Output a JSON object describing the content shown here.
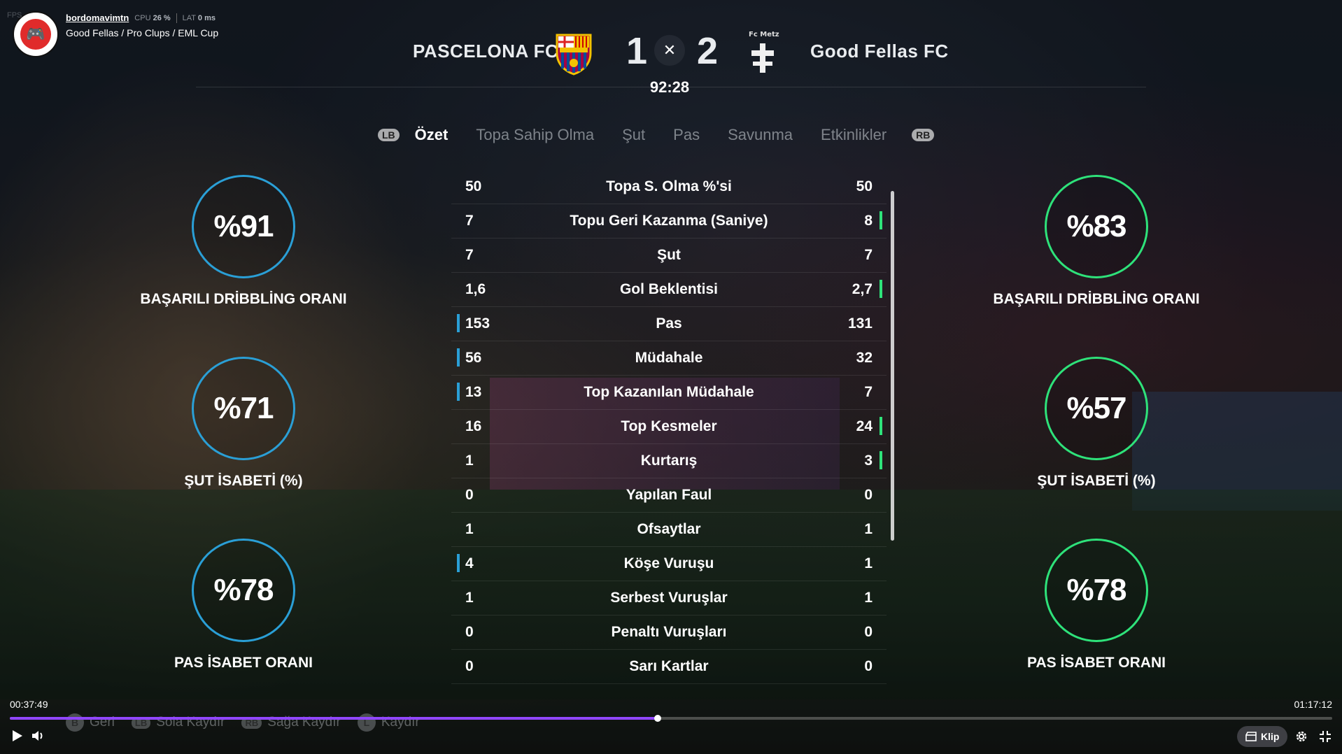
{
  "stream": {
    "username": "bordomavimtn",
    "fps_label": "FPS",
    "cpu_label": "CPU",
    "cpu_value": "26 %",
    "lat_label": "LAT",
    "lat_value": "0 ms",
    "channel": "Good Fellas / Pro Clups / EML Cup"
  },
  "match": {
    "home_team": "PASCELONA FC",
    "home_score": "1",
    "away_score": "2",
    "away_team": "Good Fellas  FC",
    "away_crest_label": "Fc Metz",
    "clock": "92:28",
    "close_icon": "✕"
  },
  "tabs": {
    "lb": "LB",
    "rb": "RB",
    "items": [
      "Özet",
      "Topa Sahip Olma",
      "Şut",
      "Pas",
      "Savunma",
      "Etkinlikler"
    ]
  },
  "gauges_left": [
    {
      "value": "%91",
      "label": "BAŞARILI DRİBBLİNG ORANI"
    },
    {
      "value": "%71",
      "label": "ŞUT İSABETİ (%)"
    },
    {
      "value": "%78",
      "label": "PAS İSABET ORANI"
    }
  ],
  "gauges_right": [
    {
      "value": "%83",
      "label": "BAŞARILI DRİBBLİNG ORANI"
    },
    {
      "value": "%57",
      "label": "ŞUT İSABETİ (%)"
    },
    {
      "value": "%78",
      "label": "PAS İSABET ORANI"
    }
  ],
  "stats": [
    {
      "home": "50",
      "name": "Topa S. Olma %'si",
      "away": "50",
      "lead": ""
    },
    {
      "home": "7",
      "name": "Topu Geri Kazanma (Saniye)",
      "away": "8",
      "lead": "away"
    },
    {
      "home": "7",
      "name": "Şut",
      "away": "7",
      "lead": ""
    },
    {
      "home": "1,6",
      "name": "Gol Beklentisi",
      "away": "2,7",
      "lead": "away"
    },
    {
      "home": "153",
      "name": "Pas",
      "away": "131",
      "lead": "home"
    },
    {
      "home": "56",
      "name": "Müdahale",
      "away": "32",
      "lead": "home"
    },
    {
      "home": "13",
      "name": "Top Kazanılan Müdahale",
      "away": "7",
      "lead": "home"
    },
    {
      "home": "16",
      "name": "Top Kesmeler",
      "away": "24",
      "lead": "away"
    },
    {
      "home": "1",
      "name": "Kurtarış",
      "away": "3",
      "lead": "away"
    },
    {
      "home": "0",
      "name": "Yapılan Faul",
      "away": "0",
      "lead": ""
    },
    {
      "home": "1",
      "name": "Ofsaytlar",
      "away": "1",
      "lead": ""
    },
    {
      "home": "4",
      "name": "Köşe Vuruşu",
      "away": "1",
      "lead": "home"
    },
    {
      "home": "1",
      "name": "Serbest Vuruşlar",
      "away": "1",
      "lead": ""
    },
    {
      "home": "0",
      "name": "Penaltı Vuruşları",
      "away": "0",
      "lead": ""
    },
    {
      "home": "0",
      "name": "Sarı Kartlar",
      "away": "0",
      "lead": ""
    }
  ],
  "hints": [
    {
      "key": "B",
      "label": "Geri"
    },
    {
      "key": "LB",
      "label": "Sola Kaydır"
    },
    {
      "key": "RB",
      "label": "Sağa Kaydır"
    },
    {
      "key": "L",
      "label": "Kaydır"
    }
  ],
  "player": {
    "elapsed": "00:37:49",
    "total": "01:17:12",
    "progress_fraction": 0.49,
    "clip_label": "Klip"
  },
  "colors": {
    "home_accent": "#2a9fd6",
    "away_accent": "#2ee27a",
    "progress": "#9146ff"
  }
}
